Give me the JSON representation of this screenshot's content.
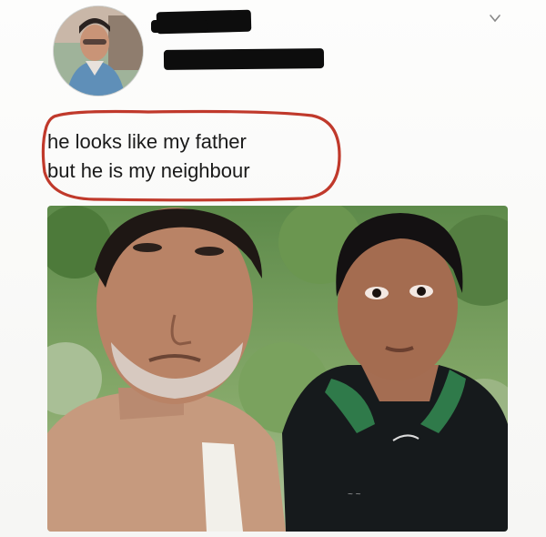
{
  "post": {
    "author_avatar_icon": "profile-photo-icon",
    "author_name": "",
    "author_handle": "",
    "menu_icon": "chevron-down-icon",
    "text_lines": [
      "he looks like my father",
      "but he is my neighbour"
    ],
    "highlight_color": "#c0392b",
    "image_icon": "selfie-photo-icon"
  }
}
